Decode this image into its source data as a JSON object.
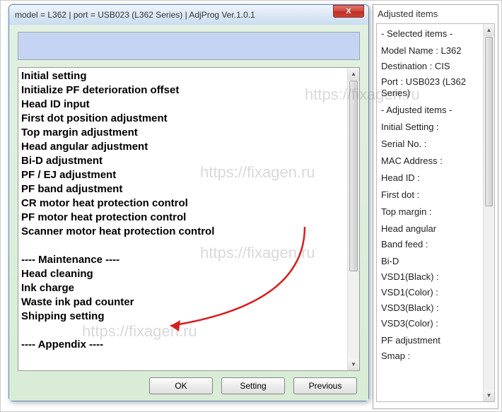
{
  "dialog": {
    "title": "model = L362 | port = USB023 (L362 Series) | AdjProg Ver.1.0.1",
    "close_label": "X",
    "list": [
      "Initial setting",
      "Initialize PF deterioration offset",
      "Head ID input",
      "First dot position adjustment",
      "Top margin adjustment",
      "Head angular adjustment",
      "Bi-D adjustment",
      "PF / EJ adjustment",
      "PF band adjustment",
      "CR motor heat protection control",
      "PF motor heat protection control",
      "Scanner motor heat protection control",
      "",
      "---- Maintenance ----",
      "Head cleaning",
      "Ink charge",
      "Waste ink pad counter",
      "Shipping setting",
      "",
      "---- Appendix ----"
    ],
    "buttons": {
      "ok": "OK",
      "setting": "Setting",
      "previous": "Previous"
    }
  },
  "side": {
    "title": "Adjusted items",
    "header_selected": "- Selected items -",
    "model": "Model Name : L362",
    "destination": "Destination : CIS",
    "port": "Port : USB023 (L362 Series)",
    "header_adjusted": "- Adjusted items -",
    "initial": "Initial Setting :",
    "serial": "Serial No. :",
    "mac": "MAC Address :",
    "headid": "Head ID :",
    "firstdot": "First dot :",
    "topmargin": "Top margin :",
    "headang": "Head angular",
    "bandfeed": " Band feed :",
    "bid": "Bi-D",
    "vsd1b": " VSD1(Black) :",
    "vsd1c": " VSD1(Color) :",
    "vsd3b": " VSD3(Black) :",
    "vsd3c": " VSD3(Color) :",
    "pfadj": "PF adjustment",
    "smap": "Smap :"
  },
  "watermark": "https://fixagen.ru"
}
